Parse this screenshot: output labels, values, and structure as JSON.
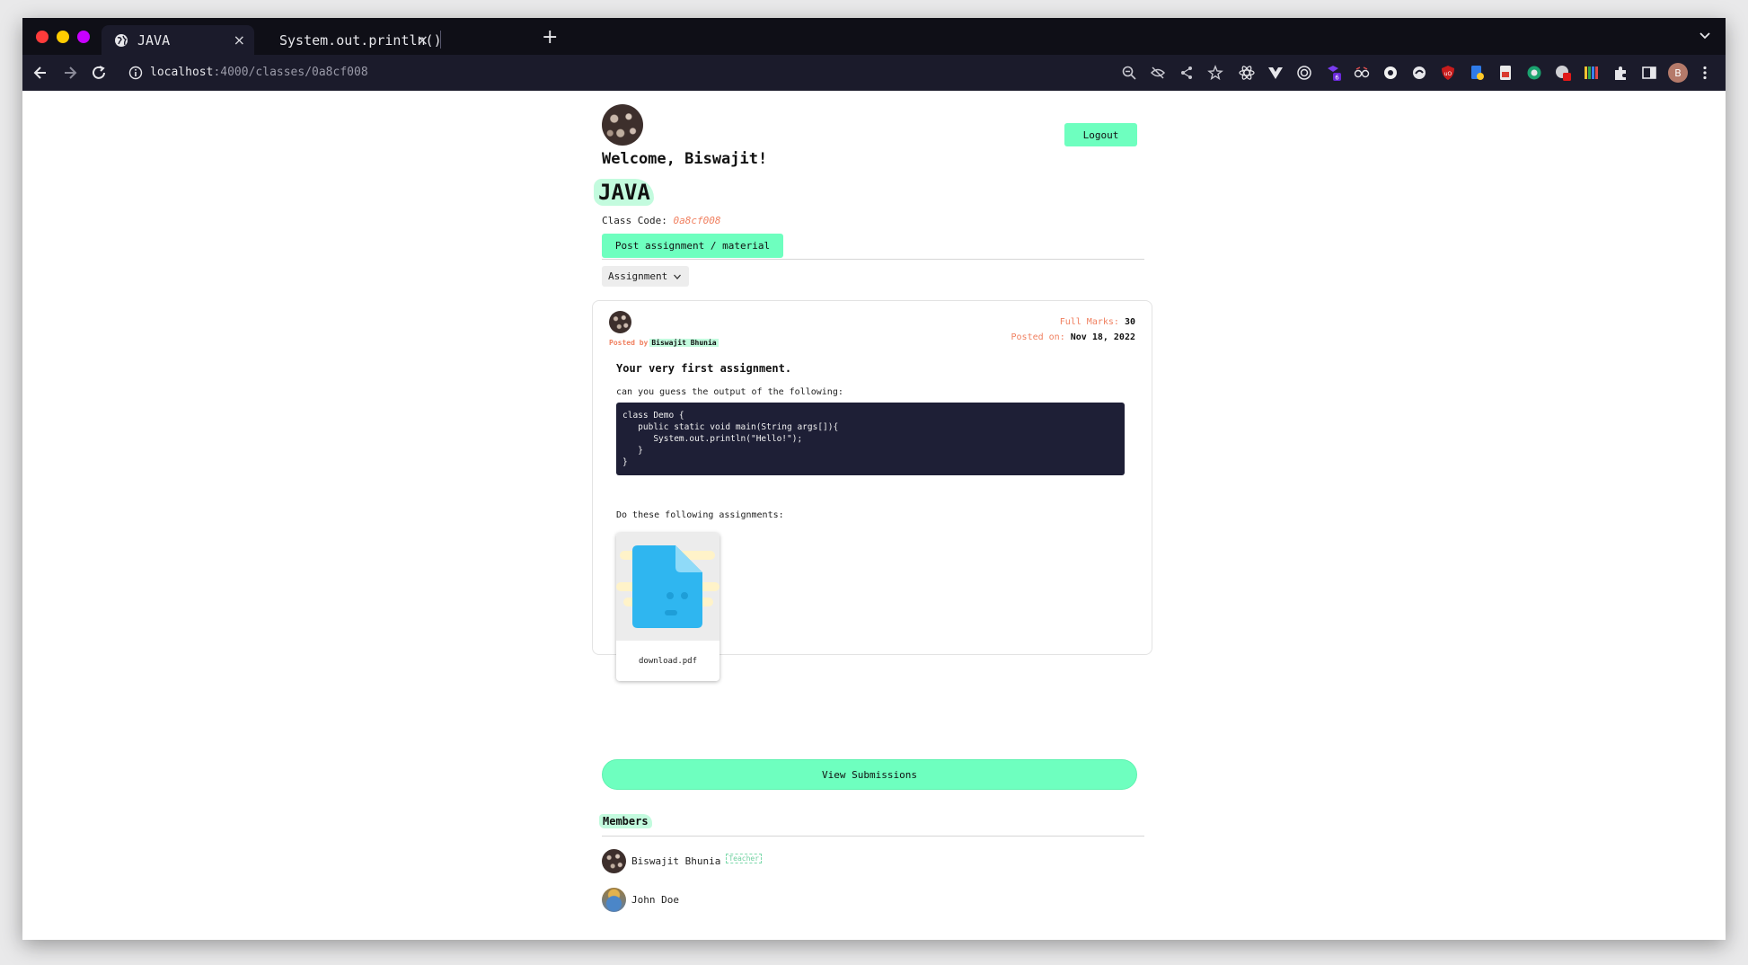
{
  "browser": {
    "tabs": [
      {
        "title": "JAVA",
        "close": "×"
      },
      {
        "title": "System.out.println()",
        "close": "×"
      }
    ],
    "new_tab": "+",
    "url_host": "localhost",
    "url_path": ":4000/classes/0a8cf008",
    "profile_initial": "B",
    "extension_badge": "6"
  },
  "header": {
    "welcome": "Welcome, Biswajit!",
    "logout_label": "Logout"
  },
  "classroom": {
    "title": "JAVA",
    "code_label": "Class Code: ",
    "code_value": "0a8cf008",
    "post_button": "Post assignment / material",
    "filter_label": "Assignment"
  },
  "assignment": {
    "posted_by_label": "Posted by",
    "posted_by_name": "Biswajit Bhunia",
    "full_marks_label": "Full Marks: ",
    "full_marks_value": "30",
    "posted_on_label": "Posted on: ",
    "posted_on_value": "Nov 18, 2022",
    "title": "Your very first assignment.",
    "prompt": "can you guess the output of the following:",
    "code": "class Demo {\n   public static void main(String args[]){\n      System.out.println(\"Hello!\");\n   }\n}",
    "followup": "Do these following assignments:",
    "attachment_name": "download.pdf",
    "view_submissions_label": "View Submissions"
  },
  "members": {
    "title": "Members",
    "list": [
      {
        "name": "Biswajit Bhunia",
        "badge": "Teacher"
      },
      {
        "name": "John Doe"
      }
    ]
  },
  "colors": {
    "accent_green": "#6effbf",
    "highlight_green": "#c3fbde",
    "label_orange": "#f08060",
    "code_bg": "#1e1f36",
    "browser_dark": "#1b1b2b"
  }
}
